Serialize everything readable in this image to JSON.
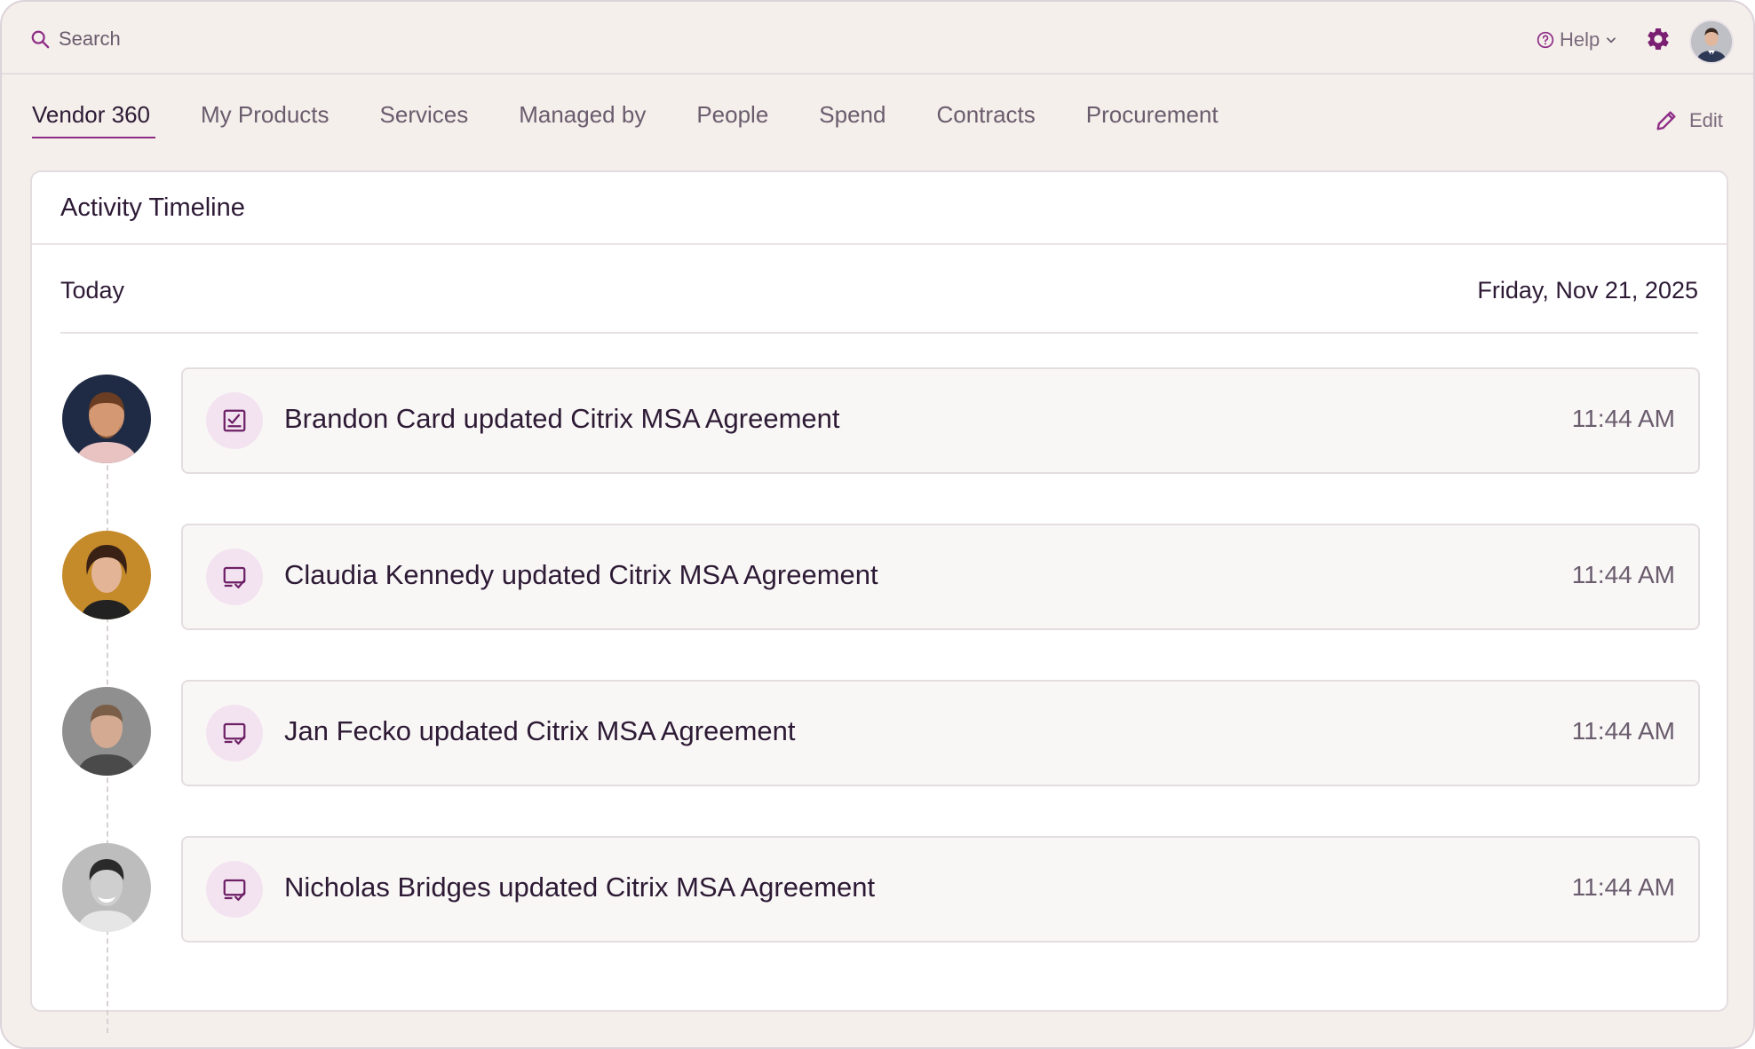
{
  "topbar": {
    "search_placeholder": "Search",
    "help_label": "Help",
    "icons": {
      "search": "search-icon",
      "help": "help-circle-icon",
      "settings": "gear-icon"
    }
  },
  "tabs": [
    {
      "label": "Vendor 360",
      "active": true
    },
    {
      "label": "My Products",
      "active": false
    },
    {
      "label": "Services",
      "active": false
    },
    {
      "label": "Managed by",
      "active": false
    },
    {
      "label": "People",
      "active": false
    },
    {
      "label": "Spend",
      "active": false
    },
    {
      "label": "Contracts",
      "active": false
    },
    {
      "label": "Procurement",
      "active": false
    }
  ],
  "edit_label": "Edit",
  "timeline": {
    "title": "Activity Timeline",
    "group_label": "Today",
    "date": "Friday, Nov 21, 2025",
    "events": [
      {
        "text": "Brandon Card updated Citrix MSA Agreement",
        "time": "11:44 AM",
        "icon": "checklist-icon"
      },
      {
        "text": "Claudia Kennedy updated Citrix MSA Agreement",
        "time": "11:44 AM",
        "icon": "document-check-icon"
      },
      {
        "text": "Jan Fecko updated Citrix MSA Agreement",
        "time": "11:44 AM",
        "icon": "document-check-icon"
      },
      {
        "text": "Nicholas Bridges updated Citrix MSA Agreement",
        "time": "11:44 AM",
        "icon": "document-check-icon"
      }
    ]
  },
  "colors": {
    "accent": "#8e2b86",
    "background": "#f4efeb",
    "text": "#2d1a35",
    "muted_text": "#6a5c6d",
    "icon_badge": "#f3e3f0"
  }
}
